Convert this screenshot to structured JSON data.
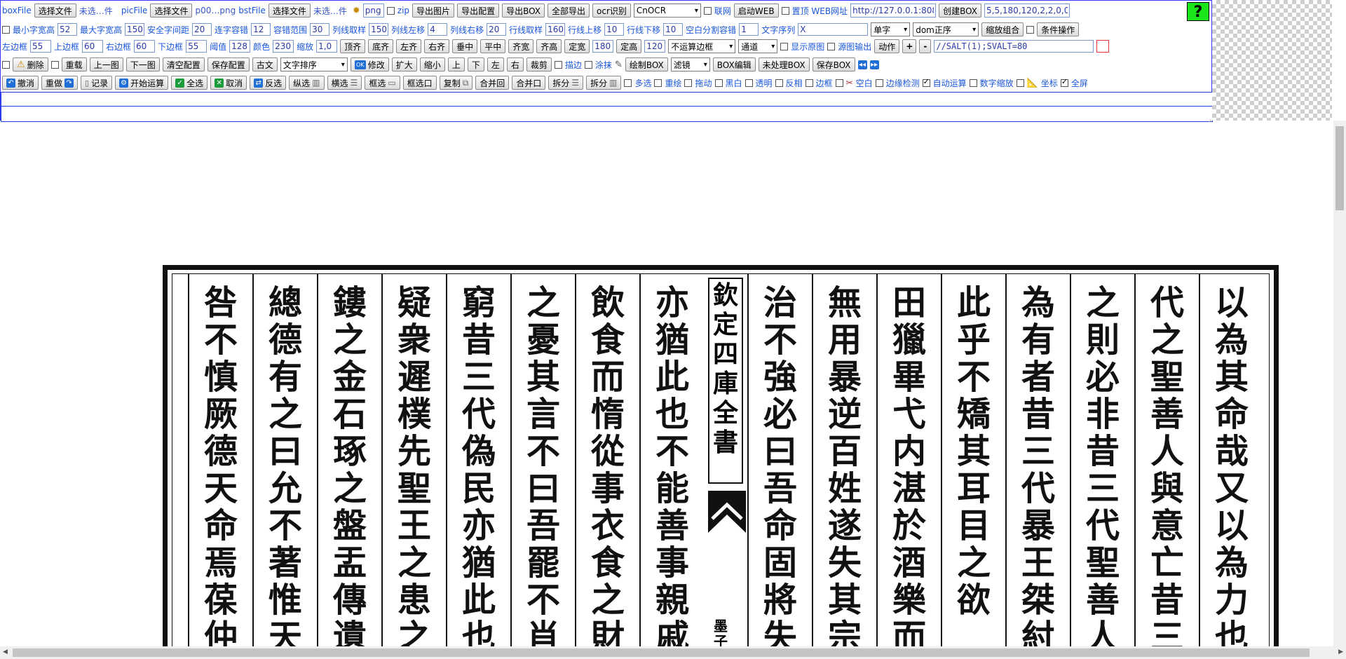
{
  "toolbar": {
    "row1": {
      "boxfile_label": "boxFile",
      "choose_file": "选择文件",
      "boxfile_status": "未选…件",
      "picfile_label": "picFile",
      "picfile_status": "p00…png",
      "bstfile_label": "bstFile",
      "bstfile_status": "未选…件",
      "format_value": "png",
      "zip_label": "zip",
      "export_image": "导出图片",
      "export_config": "导出配置",
      "export_box": "导出BOX",
      "export_all": "全部导出",
      "ocr_recognize": "ocr识别",
      "ocr_engine": "CnOCR",
      "network_label": "联网",
      "start_web": "启动WEB",
      "pin_web_url_label": "置顶 WEB网址",
      "web_url": "http://127.0.0.1:808",
      "create_box": "创建BOX",
      "box_params": "5,5,180,120,2,2,0,0",
      "help_symbol": "?"
    },
    "row2": {
      "min_char_width_label": "最小字宽高",
      "min_char_width": "52",
      "max_char_width_label": "最大字宽高",
      "max_char_width": "150",
      "safe_char_gap_label": "安全字间距",
      "safe_char_gap": "20",
      "link_char_tol_label": "连字容错",
      "link_char_tol": "12",
      "tol_range_label": "容错范围",
      "tol_range": "30",
      "col_line_sample_label": "列线取样",
      "col_line_sample": "150",
      "col_line_left_label": "列线左移",
      "col_line_left": "4",
      "col_line_right_label": "列线右移",
      "col_line_right": "20",
      "row_line_sample_label": "行线取样",
      "row_line_sample": "160",
      "row_line_up_label": "行线上移",
      "row_line_up": "10",
      "row_line_down_label": "行线下移",
      "row_line_down": "10",
      "blank_split_tol_label": "空白分割容错",
      "blank_split_tol": "1",
      "text_sequence_label": "文字序列",
      "text_sequence": "X",
      "single_char": "单字",
      "dom_order": "dom正序",
      "zoom_combo": "缩放组合",
      "condition_op": "条件操作"
    },
    "row3": {
      "left_margin_label": "左边框",
      "left_margin": "55",
      "top_margin_label": "上边框",
      "top_margin": "60",
      "right_margin_label": "右边框",
      "right_margin": "60",
      "bottom_margin_label": "下边框",
      "bottom_margin": "55",
      "threshold_label": "阈值",
      "threshold": "128",
      "color_label": "颜色",
      "color": "230",
      "scale_label": "缩放",
      "scale": "1,0",
      "align_top": "顶齐",
      "align_bottom": "底齐",
      "align_left": "左齐",
      "align_right": "右齐",
      "v_center": "垂中",
      "h_center": "平中",
      "same_width": "齐宽",
      "same_height": "齐高",
      "fix_width": "定宽",
      "fix_width_value": "180",
      "fix_height": "定高",
      "fix_height_value": "120",
      "border_mode": "不运算边框",
      "channel": "通道",
      "show_original_label": "显示原图",
      "source_output_label": "源图输出",
      "action": "动作",
      "plus": "+",
      "minus": "-",
      "script_text": "//SALT(1);SVALT=80"
    },
    "row4": {
      "delete": "删除",
      "reload": "重载",
      "prev_image": "上一图",
      "next_image": "下一图",
      "clear_config": "清空配置",
      "save_config": "保存配置",
      "ancient_text": "古文",
      "text_sort": "文字排序",
      "modify_ok": "OK",
      "modify": "修改",
      "enlarge": "扩大",
      "shrink": "缩小",
      "up": "上",
      "down": "下",
      "left": "左",
      "right": "右",
      "crop": "裁剪",
      "stroke_label": "描边",
      "erase_label": "涂抹",
      "draw_box": "绘制BOX",
      "filter": "滤镜",
      "box_edit": "BOX编辑",
      "unprocessed_box": "未处理BOX",
      "save_box": "保存BOX"
    },
    "row5": {
      "undo": "撤消",
      "redo": "重做",
      "record": "记录",
      "start_compute": "开始运算",
      "select_all": "全选",
      "cancel": "取消",
      "invert_select": "反选",
      "vertical_select": "纵选",
      "horizontal_select": "横选",
      "box_select": "框选",
      "box_select_mouth": "框选口",
      "copy": "复制",
      "merge_back": "合并回",
      "merge_mouth": "合并口",
      "split_3": "拆分",
      "split_col": "拆分",
      "multi_select_label": "多选",
      "redraw_label": "重绘",
      "drag_label": "拖动",
      "bw_label": "黑白",
      "transparent_label": "透明",
      "invert_color_label": "反相",
      "border_label": "边框",
      "blank_label": "空白",
      "edge_detect_label": "边缘检测",
      "auto_compute_label": "自动运算",
      "digit_scale_label": "数字缩放",
      "coords_label": "坐标",
      "fullscreen_label": "全屏"
    }
  },
  "document": {
    "columns": [
      "以為其命哉又以為力也",
      "代之聖善人與意亡昔三",
      "之則必非昔三代聖善人",
      "為有者昔三代暴王桀紂",
      "此乎不矯其耳目之欲",
      "田獵畢弋内湛於酒樂而",
      "無用暴逆百姓遂失其宗",
      "治不強必曰吾命固將失",
      "亦猶此也不能善事親戚",
      "飲食而惰從事衣食之財",
      "之憂其言不曰吾罷不肖",
      "窮昔三代偽民亦猶此也",
      "疑衆遲樸先聖王之患之",
      "鏤之金石琢之盤盂傳遺",
      "總德有之曰允不著惟天",
      "咎不慎厥德天命焉葆仲"
    ],
    "center_title": "欽定四庫全書",
    "center_juan": "墨子卷"
  },
  "colors": {
    "panel_border": "#3a3aff",
    "label_blue": "#1a56db",
    "help_green": "#1be51b",
    "ink": "#111111"
  }
}
